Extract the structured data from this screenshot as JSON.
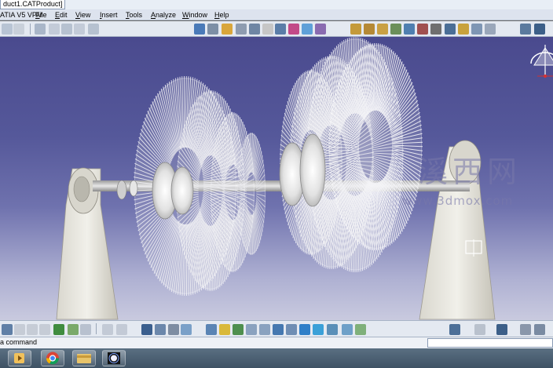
{
  "window": {
    "title": "duct1.CATProduct]",
    "app_name": "ATIA V5 VPM"
  },
  "menu": {
    "items": [
      {
        "label": "File",
        "underline": "F",
        "rest": "ile"
      },
      {
        "label": "Edit",
        "underline": "E",
        "rest": "dit"
      },
      {
        "label": "View",
        "underline": "V",
        "rest": "iew"
      },
      {
        "label": "Insert",
        "underline": "I",
        "rest": "nsert"
      },
      {
        "label": "Tools",
        "underline": "T",
        "rest": "ools"
      },
      {
        "label": "Analyze",
        "underline": "A",
        "rest": "nalyze"
      },
      {
        "label": "Window",
        "underline": "W",
        "rest": "indow"
      },
      {
        "label": "Help",
        "underline": "H",
        "rest": "elp"
      }
    ]
  },
  "viewport": {
    "watermark_chinese": "溪西网",
    "watermark_url": "www.3dmox.com",
    "compass": "compass-icon",
    "axis_icon": "axis-icon"
  },
  "statusbar": {
    "command_label": "a command",
    "command_input": ""
  },
  "taskbar": {
    "items": [
      {
        "name": "media-player-icon"
      },
      {
        "name": "chrome-icon"
      },
      {
        "name": "file-explorer-icon"
      },
      {
        "name": "catia-icon"
      }
    ]
  },
  "colors": {
    "viewport_top": "#4a4a8e",
    "viewport_bottom": "#c9cadf",
    "menubar": "#dde3ee",
    "toolbar": "#e4e9f1",
    "taskbar": "#4a5f72",
    "part": "#e9e7df"
  }
}
